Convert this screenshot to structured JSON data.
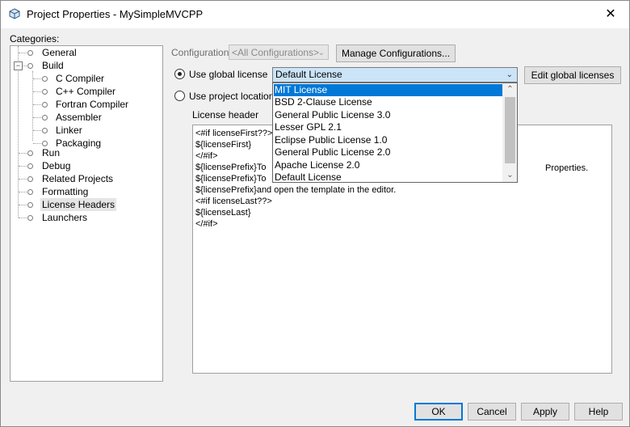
{
  "window": {
    "title": "Project Properties - MySimpleMVCPP",
    "close_glyph": "✕"
  },
  "categories": {
    "label": "Categories:",
    "items": [
      {
        "label": "General"
      },
      {
        "label": "Build"
      },
      {
        "label": "C Compiler"
      },
      {
        "label": "C++ Compiler"
      },
      {
        "label": "Fortran Compiler"
      },
      {
        "label": "Assembler"
      },
      {
        "label": "Linker"
      },
      {
        "label": "Packaging"
      },
      {
        "label": "Run"
      },
      {
        "label": "Debug"
      },
      {
        "label": "Related Projects"
      },
      {
        "label": "Formatting"
      },
      {
        "label": "License Headers"
      },
      {
        "label": "Launchers"
      }
    ],
    "selected": "License Headers"
  },
  "config": {
    "label": "Configuration:",
    "value": "<All Configurations>",
    "manage_button": "Manage Configurations..."
  },
  "license": {
    "use_global_label": "Use global license",
    "use_project_label": "Use project location",
    "combo_value": "Default License",
    "edit_global_button": "Edit global licenses",
    "options": [
      "MIT License",
      "BSD 2-Clause License",
      "General Public License 3.0",
      "Lesser GPL 2.1",
      "Eclipse Public License 1.0",
      "General Public License 2.0",
      "Apache License 2.0",
      "Default License"
    ],
    "highlighted": "MIT License"
  },
  "header": {
    "label": "License header",
    "lines": [
      "<#if licenseFirst??>",
      "${licenseFirst}",
      "</#if>",
      "${licensePrefix}To",
      "${licensePrefix}To",
      "${licensePrefix}and open the template in the editor.",
      "<#if licenseLast??>",
      "${licenseLast}",
      "</#if>"
    ],
    "visible_suffix": "Properties."
  },
  "buttons": {
    "ok": "OK",
    "cancel": "Cancel",
    "apply": "Apply",
    "help": "Help"
  },
  "colors": {
    "accent": "#0078d7",
    "combo_bg": "#cce4f7"
  }
}
